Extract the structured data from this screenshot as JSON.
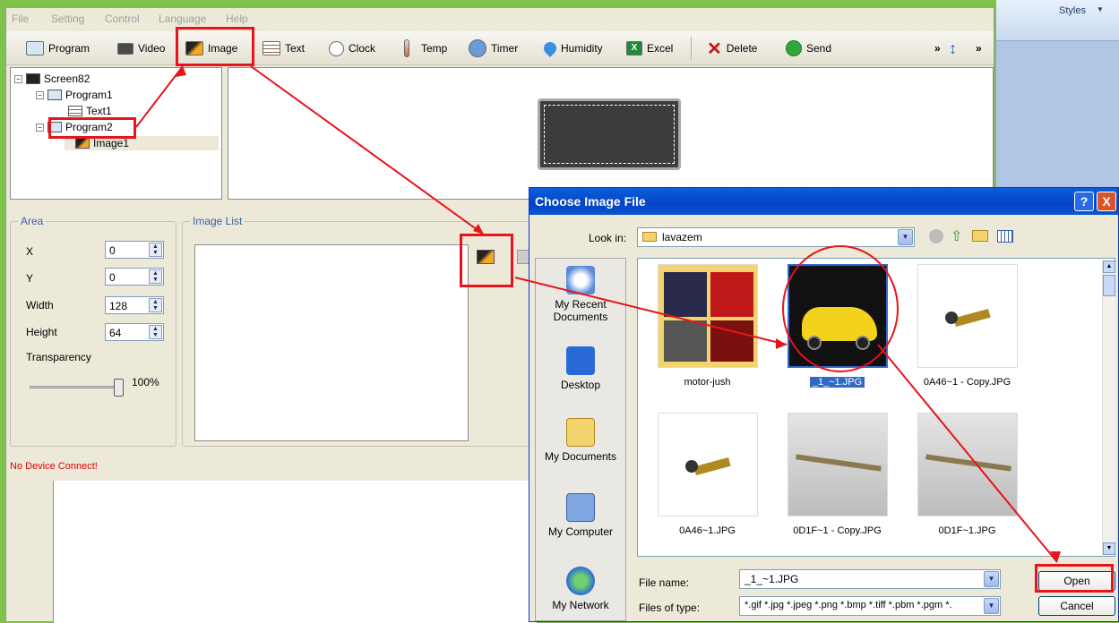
{
  "menu": [
    "File",
    "Setting",
    "Control",
    "Language",
    "Help"
  ],
  "toolbar": {
    "program": "Program",
    "video": "Video",
    "image": "Image",
    "text": "Text",
    "clock": "Clock",
    "temp": "Temp",
    "timer": "Timer",
    "humidity": "Humidity",
    "excel": "Excel",
    "delete": "Delete",
    "send": "Send",
    "more1": "»",
    "more2": "»"
  },
  "tree": {
    "screen": "Screen82",
    "program1": "Program1",
    "text1": "Text1",
    "program2": "Program2",
    "image1": "Image1"
  },
  "area": {
    "title": "Area",
    "x_label": "X",
    "x_value": "0",
    "y_label": "Y",
    "y_value": "0",
    "width_label": "Width",
    "width_value": "128",
    "height_label": "Height",
    "height_value": "64",
    "transparency_label": "Transparency",
    "transparency_value": "100%"
  },
  "image_list": {
    "title": "Image List"
  },
  "status": "No Device Connect!",
  "word": {
    "styles": "Styles"
  },
  "dialog": {
    "title": "Choose Image File",
    "look_in_label": "Look in:",
    "look_in_value": "lavazem",
    "places": [
      "My Recent Documents",
      "Desktop",
      "My Documents",
      "My Computer",
      "My Network"
    ],
    "files": [
      "motor-jush",
      "_1_~1.JPG",
      "0A46~1 - Copy.JPG",
      "0A46~1.JPG",
      "0D1F~1 - Copy.JPG",
      "0D1F~1.JPG"
    ],
    "file_name_label": "File name:",
    "file_name_value": "_1_~1.JPG",
    "file_type_label": "Files of type:",
    "file_type_value": "*.gif *.jpg *.jpeg *.png *.bmp *.tiff *.pbm *.pgm *.",
    "open": "Open",
    "cancel": "Cancel",
    "help": "?",
    "close": "X"
  },
  "colors": {
    "accent_red": "#e8141b",
    "titlebar_blue": "#0a5fdc",
    "status_red": "#e00000"
  }
}
